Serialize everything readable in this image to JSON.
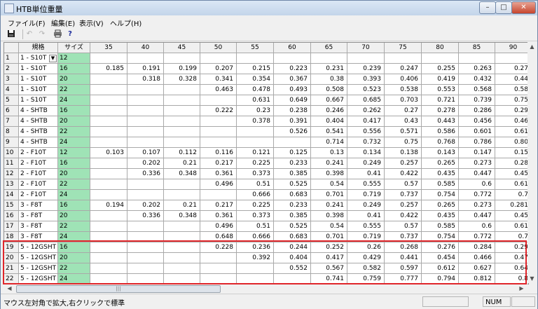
{
  "window": {
    "title": "HTB単位重量"
  },
  "controls": {
    "minimize": "–",
    "maximize": "□",
    "close": "✕"
  },
  "menu": [
    {
      "label": "ファイル(F)"
    },
    {
      "label": "編集(E)"
    },
    {
      "label": "表示(V)"
    },
    {
      "label": "ヘルプ(H)"
    }
  ],
  "toolbar": {
    "icons": [
      "save-icon",
      "undo-icon",
      "redo-icon",
      "print-icon",
      "help-icon"
    ]
  },
  "grid": {
    "headers": [
      "",
      "規格",
      "サイズ",
      "35",
      "40",
      "45",
      "50",
      "55",
      "60",
      "65",
      "70",
      "75",
      "80",
      "85",
      "90"
    ],
    "rows": [
      {
        "n": "1",
        "k": "1 - S10T",
        "s": "12",
        "v": [
          "",
          "",
          "",
          "",
          "",
          "",
          "",
          "",
          "",
          "",
          "",
          ""
        ],
        "dropdown": true
      },
      {
        "n": "2",
        "k": "1 - S10T",
        "s": "16",
        "v": [
          "0.185",
          "0.191",
          "0.199",
          "0.207",
          "0.215",
          "0.223",
          "0.231",
          "0.239",
          "0.247",
          "0.255",
          "0.263",
          "0.27"
        ]
      },
      {
        "n": "3",
        "k": "1 - S10T",
        "s": "20",
        "v": [
          "",
          "0.318",
          "0.328",
          "0.341",
          "0.354",
          "0.367",
          "0.38",
          "0.393",
          "0.406",
          "0.419",
          "0.432",
          "0.44"
        ]
      },
      {
        "n": "4",
        "k": "1 - S10T",
        "s": "22",
        "v": [
          "",
          "",
          "",
          "0.463",
          "0.478",
          "0.493",
          "0.508",
          "0.523",
          "0.538",
          "0.553",
          "0.568",
          "0.58"
        ]
      },
      {
        "n": "5",
        "k": "1 - S10T",
        "s": "24",
        "v": [
          "",
          "",
          "",
          "",
          "0.631",
          "0.649",
          "0.667",
          "0.685",
          "0.703",
          "0.721",
          "0.739",
          "0.75"
        ]
      },
      {
        "n": "6",
        "k": "4 - SHTB",
        "s": "16",
        "v": [
          "",
          "",
          "",
          "0.222",
          "0.23",
          "0.238",
          "0.246",
          "0.262",
          "0.27",
          "0.278",
          "0.286",
          "0.29"
        ]
      },
      {
        "n": "7",
        "k": "4 - SHTB",
        "s": "20",
        "v": [
          "",
          "",
          "",
          "",
          "0.378",
          "0.391",
          "0.404",
          "0.417",
          "0.43",
          "0.443",
          "0.456",
          "0.46"
        ]
      },
      {
        "n": "8",
        "k": "4 - SHTB",
        "s": "22",
        "v": [
          "",
          "",
          "",
          "",
          "",
          "0.526",
          "0.541",
          "0.556",
          "0.571",
          "0.586",
          "0.601",
          "0.61"
        ]
      },
      {
        "n": "9",
        "k": "4 - SHTB",
        "s": "24",
        "v": [
          "",
          "",
          "",
          "",
          "",
          "",
          "0.714",
          "0.732",
          "0.75",
          "0.768",
          "0.786",
          "0.80"
        ]
      },
      {
        "n": "10",
        "k": "2 - F10T",
        "s": "12",
        "v": [
          "0.103",
          "0.107",
          "0.112",
          "0.116",
          "0.121",
          "0.125",
          "0.13",
          "0.134",
          "0.138",
          "0.143",
          "0.147",
          "0.15"
        ]
      },
      {
        "n": "11",
        "k": "2 - F10T",
        "s": "16",
        "v": [
          "",
          "0.202",
          "0.21",
          "0.217",
          "0.225",
          "0.233",
          "0.241",
          "0.249",
          "0.257",
          "0.265",
          "0.273",
          "0.28"
        ]
      },
      {
        "n": "12",
        "k": "2 - F10T",
        "s": "20",
        "v": [
          "",
          "0.336",
          "0.348",
          "0.361",
          "0.373",
          "0.385",
          "0.398",
          "0.41",
          "0.422",
          "0.435",
          "0.447",
          "0.45"
        ]
      },
      {
        "n": "13",
        "k": "2 - F10T",
        "s": "22",
        "v": [
          "",
          "",
          "",
          "0.496",
          "0.51",
          "0.525",
          "0.54",
          "0.555",
          "0.57",
          "0.585",
          "0.6",
          "0.61"
        ]
      },
      {
        "n": "14",
        "k": "2 - F10T",
        "s": "24",
        "v": [
          "",
          "",
          "",
          "",
          "0.666",
          "0.683",
          "0.701",
          "0.719",
          "0.737",
          "0.754",
          "0.772",
          "0.7"
        ]
      },
      {
        "n": "15",
        "k": "3 - F8T",
        "s": "16",
        "v": [
          "0.194",
          "0.202",
          "0.21",
          "0.217",
          "0.225",
          "0.233",
          "0.241",
          "0.249",
          "0.257",
          "0.265",
          "0.273",
          "0.281",
          "0.28"
        ]
      },
      {
        "n": "16",
        "k": "3 - F8T",
        "s": "20",
        "v": [
          "",
          "0.336",
          "0.348",
          "0.361",
          "0.373",
          "0.385",
          "0.398",
          "0.41",
          "0.422",
          "0.435",
          "0.447",
          "0.45"
        ]
      },
      {
        "n": "17",
        "k": "3 - F8T",
        "s": "22",
        "v": [
          "",
          "",
          "",
          "0.496",
          "0.51",
          "0.525",
          "0.54",
          "0.555",
          "0.57",
          "0.585",
          "0.6",
          "0.61"
        ]
      },
      {
        "n": "18",
        "k": "3 - F8T",
        "s": "24",
        "v": [
          "",
          "",
          "",
          "0.648",
          "0.666",
          "0.683",
          "0.701",
          "0.719",
          "0.737",
          "0.754",
          "0.772",
          "0.7"
        ]
      },
      {
        "n": "19",
        "k": "5 - 12GSHT",
        "s": "16",
        "v": [
          "",
          "",
          "",
          "0.228",
          "0.236",
          "0.244",
          "0.252",
          "0.26",
          "0.268",
          "0.276",
          "0.284",
          "0.29"
        ]
      },
      {
        "n": "20",
        "k": "5 - 12GSHT",
        "s": "20",
        "v": [
          "",
          "",
          "",
          "",
          "0.392",
          "0.404",
          "0.417",
          "0.429",
          "0.441",
          "0.454",
          "0.466",
          "0.47"
        ]
      },
      {
        "n": "21",
        "k": "5 - 12GSHT",
        "s": "22",
        "v": [
          "",
          "",
          "",
          "",
          "",
          "0.552",
          "0.567",
          "0.582",
          "0.597",
          "0.612",
          "0.627",
          "0.64"
        ]
      },
      {
        "n": "22",
        "k": "5 - 12GSHT",
        "s": "24",
        "v": [
          "",
          "",
          "",
          "",
          "",
          "",
          "0.741",
          "0.759",
          "0.777",
          "0.794",
          "0.812",
          "0.8"
        ]
      }
    ]
  },
  "status": {
    "text": "マウス左対角で拡大,右クリックで標準",
    "num": "NUM"
  }
}
